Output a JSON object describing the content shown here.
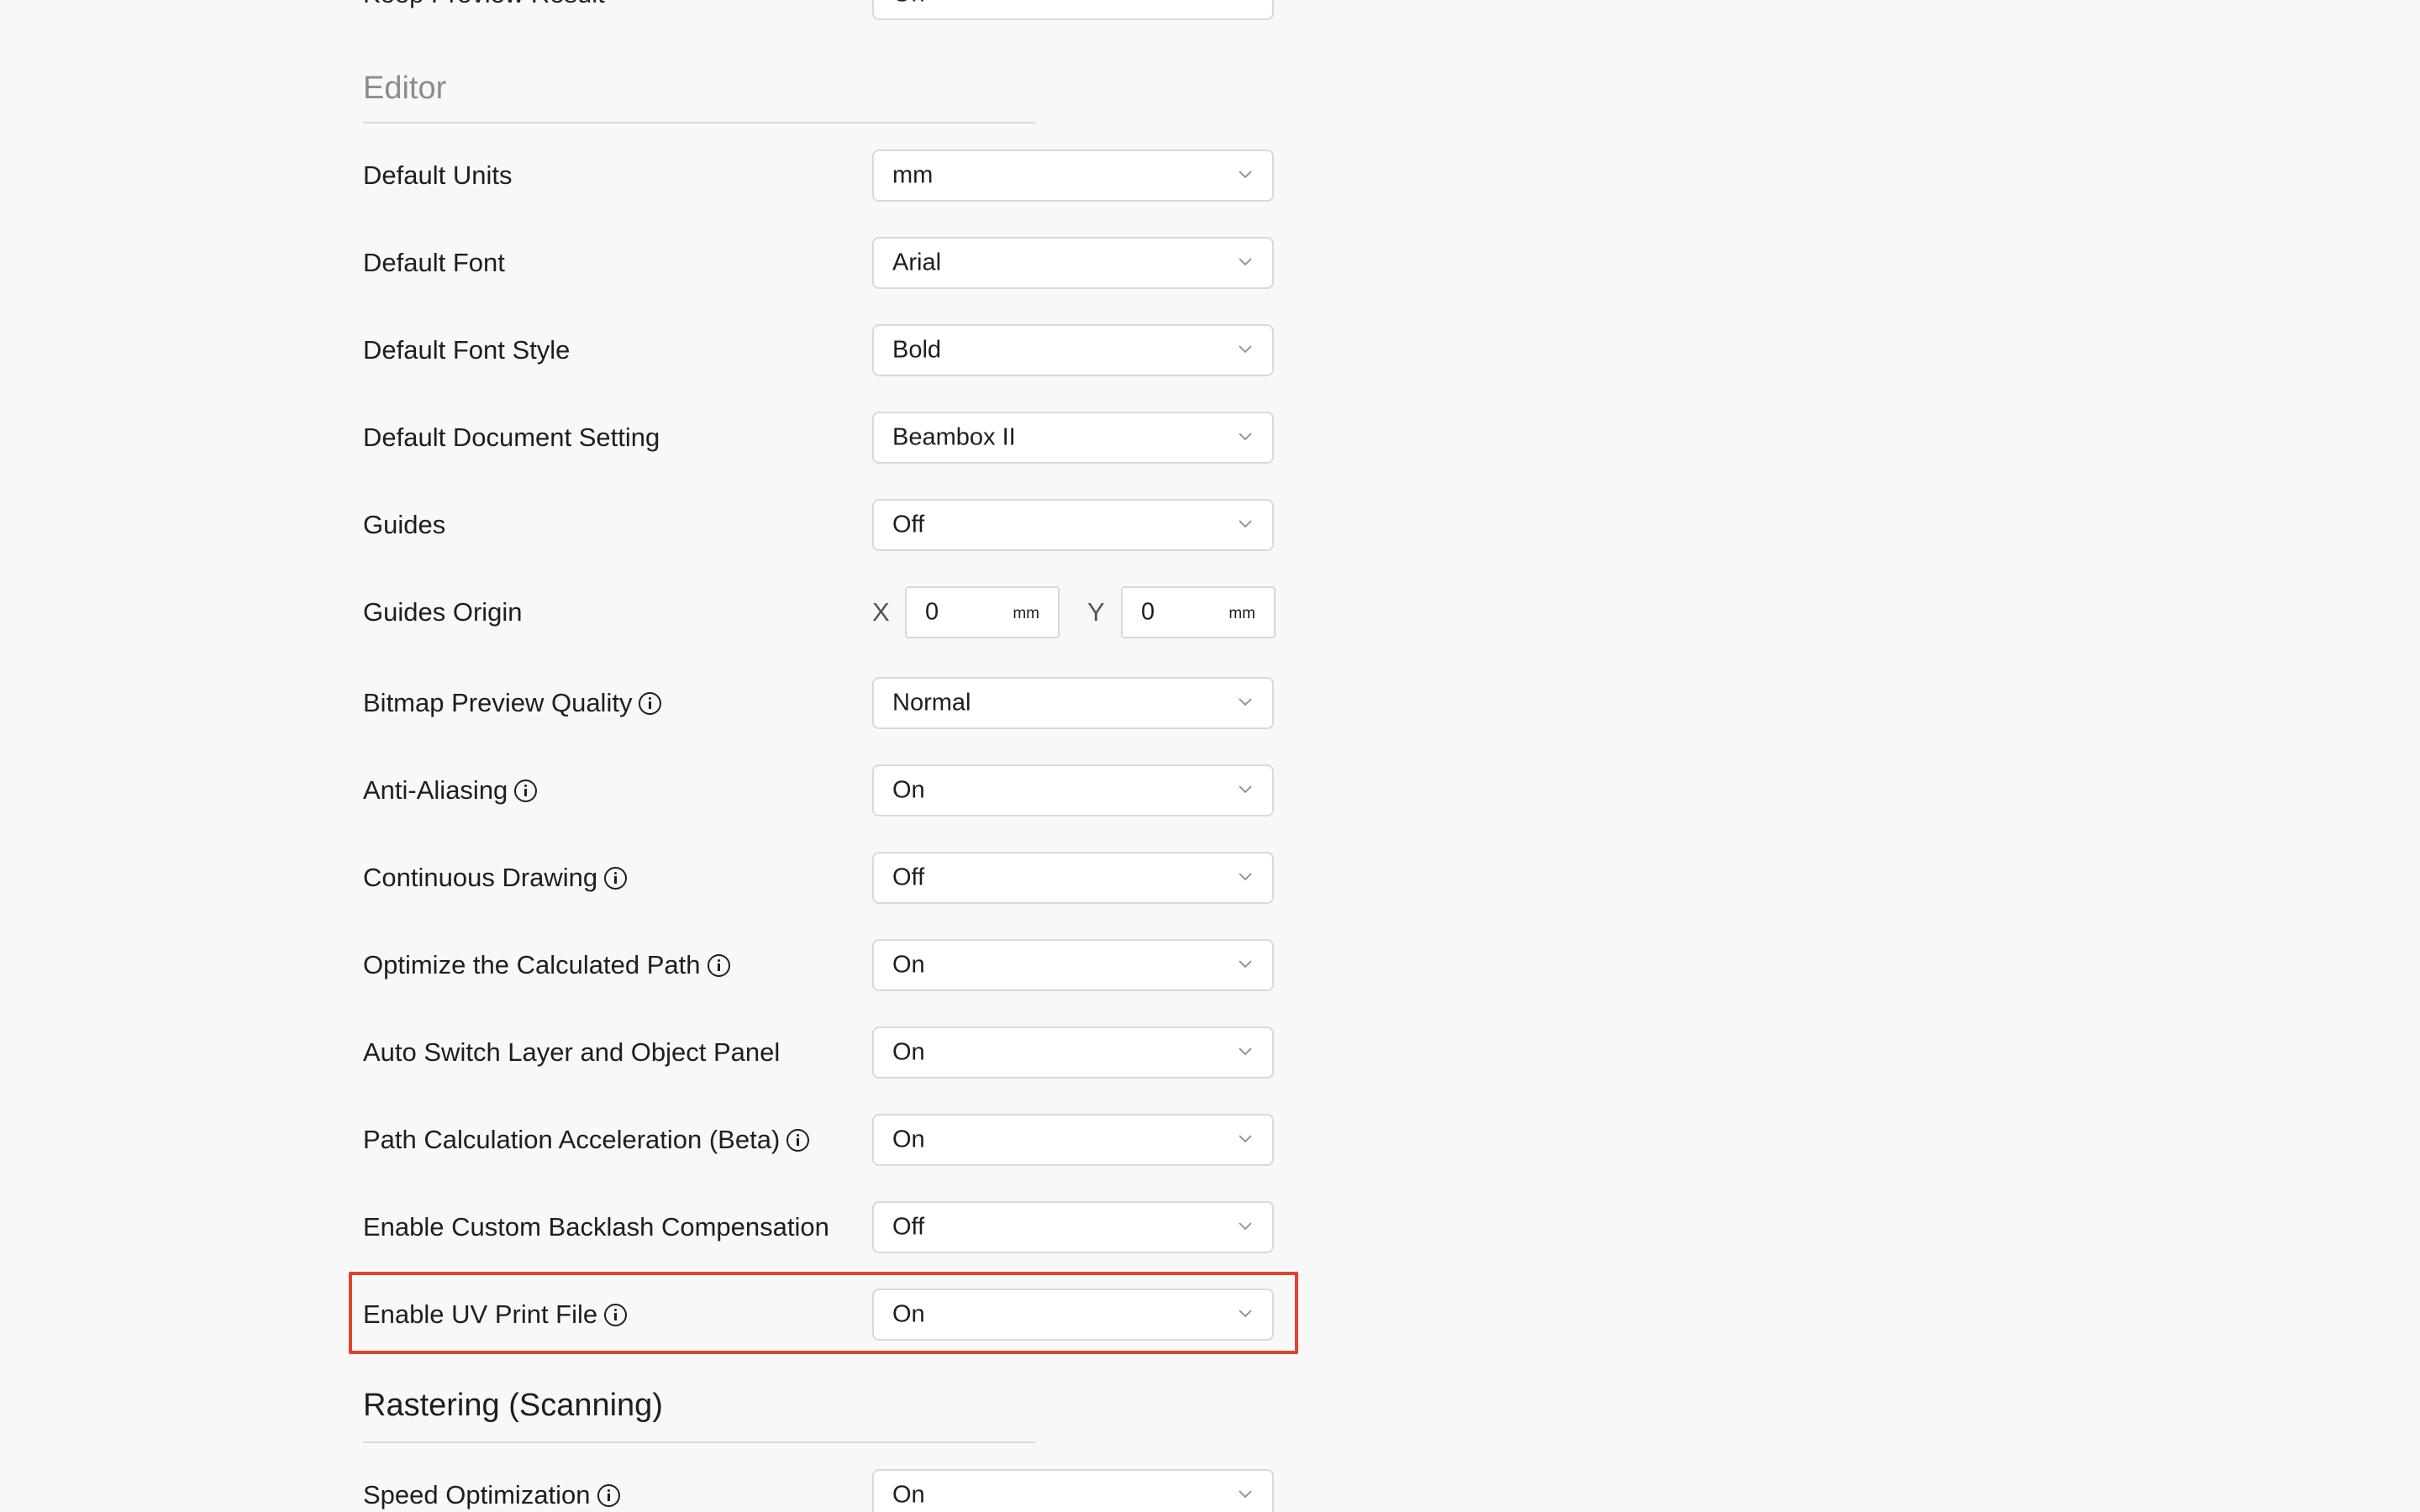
{
  "top_row": {
    "label": "Keep Preview Result",
    "value": "On"
  },
  "editor": {
    "title": "Editor",
    "settings": [
      {
        "label": "Default Units",
        "value": "mm",
        "info": false
      },
      {
        "label": "Default Font",
        "value": "Arial",
        "info": false
      },
      {
        "label": "Default Font Style",
        "value": "Bold",
        "info": false
      },
      {
        "label": "Default Document Setting",
        "value": "Beambox II",
        "info": false
      },
      {
        "label": "Guides",
        "value": "Off",
        "info": false
      }
    ],
    "guides_origin": {
      "label": "Guides Origin",
      "x_label": "X",
      "x_value": "0",
      "x_unit": "mm",
      "y_label": "Y",
      "y_value": "0",
      "y_unit": "mm"
    },
    "settings2": [
      {
        "label": "Bitmap Preview Quality",
        "value": "Normal",
        "info": true
      },
      {
        "label": "Anti-Aliasing",
        "value": "On",
        "info": true
      },
      {
        "label": "Continuous Drawing",
        "value": "Off",
        "info": true
      },
      {
        "label": "Optimize the Calculated Path",
        "value": "On",
        "info": true
      },
      {
        "label": "Auto Switch Layer and Object Panel",
        "value": "On",
        "info": false
      },
      {
        "label": "Path Calculation Acceleration (Beta)",
        "value": "On",
        "info": true
      },
      {
        "label": "Enable Custom Backlash Compensation",
        "value": "Off",
        "info": false
      },
      {
        "label": "Enable UV Print File",
        "value": "On",
        "info": true
      }
    ]
  },
  "rastering": {
    "title": "Rastering (Scanning)",
    "settings": [
      {
        "label": "Speed Optimization",
        "value": "On",
        "info": true
      }
    ]
  },
  "highlight_color": "#e0432e"
}
